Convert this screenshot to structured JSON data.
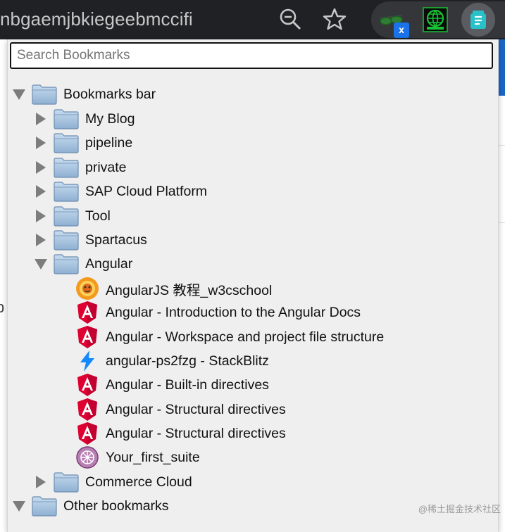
{
  "browser": {
    "url_fragment": "nbgaemjbkiegeebmccifi",
    "extension_badge": "x"
  },
  "search": {
    "placeholder": "Search Bookmarks"
  },
  "tree": {
    "root": {
      "label": "Bookmarks bar",
      "expanded": true
    },
    "folders": [
      {
        "label": "My Blog",
        "expanded": false
      },
      {
        "label": "pipeline",
        "expanded": false
      },
      {
        "label": "private",
        "expanded": false
      },
      {
        "label": "SAP Cloud Platform",
        "expanded": false
      },
      {
        "label": "Tool",
        "expanded": false
      },
      {
        "label": "Spartacus",
        "expanded": false
      },
      {
        "label": "Angular",
        "expanded": true
      }
    ],
    "angular_children": [
      {
        "label": "AngularJS 教程_w3cschool",
        "icon": "w3cschool-icon"
      },
      {
        "label": "Angular - Introduction to the Angular Docs",
        "icon": "angular-icon"
      },
      {
        "label": "Angular - Workspace and project file structure",
        "icon": "angular-icon"
      },
      {
        "label": "angular-ps2fzg - StackBlitz",
        "icon": "stackblitz-icon"
      },
      {
        "label": "Angular - Built-in directives",
        "icon": "angular-icon"
      },
      {
        "label": "Angular - Structural directives",
        "icon": "angular-icon"
      },
      {
        "label": "Angular - Structural directives",
        "icon": "angular-icon"
      },
      {
        "label": "Your_first_suite",
        "icon": "suite-icon"
      }
    ],
    "after_angular": {
      "label": "Commerce Cloud",
      "expanded": false
    },
    "other": {
      "label": "Other bookmarks",
      "expanded": true
    }
  },
  "watermark": "@稀土掘金技术社区",
  "colors": {
    "angular_red": "#dd0031",
    "folder_fill": "#9cbbd9",
    "folder_stroke": "#6e8fb0",
    "arrow": "#7a7a7a"
  }
}
